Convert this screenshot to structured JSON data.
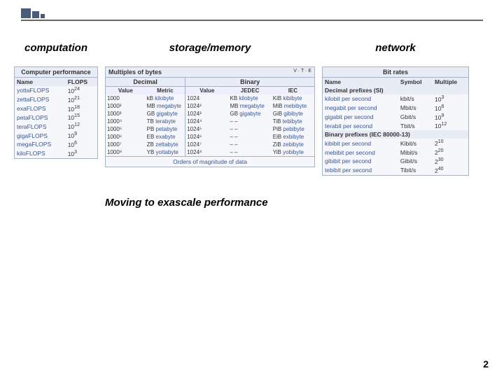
{
  "headers": {
    "computation": "computation",
    "storage": "storage/memory",
    "network": "network"
  },
  "perf": {
    "title": "Computer performance",
    "cols": [
      "Name",
      "FLOPS"
    ],
    "rows": [
      {
        "name": "yottaFLOPS",
        "exp": "24"
      },
      {
        "name": "zettaFLOPS",
        "exp": "21"
      },
      {
        "name": "exaFLOPS",
        "exp": "18"
      },
      {
        "name": "petaFLOPS",
        "exp": "15"
      },
      {
        "name": "teraFLOPS",
        "exp": "12"
      },
      {
        "name": "gigaFLOPS",
        "exp": "9"
      },
      {
        "name": "megaFLOPS",
        "exp": "6"
      },
      {
        "name": "kiloFLOPS",
        "exp": "3"
      }
    ]
  },
  "bytes": {
    "title": "Multiples of bytes",
    "nav": "V · T · E",
    "dec_head": "Decimal",
    "bin_head": "Binary",
    "dec_cols": [
      "Value",
      "Metric"
    ],
    "bin_cols": [
      "Value",
      "JEDEC",
      "IEC"
    ],
    "rows": [
      {
        "dv": "1000",
        "dp": "kB",
        "dn": "kilobyte",
        "bv": "1024",
        "jp": "KB",
        "jn": "kilobyte",
        "ip": "KiB",
        "in": "kibibyte"
      },
      {
        "dv": "1000²",
        "dp": "MB",
        "dn": "megabyte",
        "bv": "1024²",
        "jp": "MB",
        "jn": "megabyte",
        "ip": "MiB",
        "in": "mebibyte"
      },
      {
        "dv": "1000³",
        "dp": "GB",
        "dn": "gigabyte",
        "bv": "1024³",
        "jp": "GB",
        "jn": "gigabyte",
        "ip": "GiB",
        "in": "gibibyte"
      },
      {
        "dv": "1000⁴",
        "dp": "TB",
        "dn": "terabyte",
        "bv": "1024⁴",
        "jp": "–",
        "jn": "–",
        "ip": "TiB",
        "in": "tebibyte"
      },
      {
        "dv": "1000⁵",
        "dp": "PB",
        "dn": "petabyte",
        "bv": "1024⁵",
        "jp": "–",
        "jn": "–",
        "ip": "PiB",
        "in": "pebibyte"
      },
      {
        "dv": "1000⁶",
        "dp": "EB",
        "dn": "exabyte",
        "bv": "1024⁶",
        "jp": "–",
        "jn": "–",
        "ip": "EiB",
        "in": "exbibyte"
      },
      {
        "dv": "1000⁷",
        "dp": "ZB",
        "dn": "zettabyte",
        "bv": "1024⁷",
        "jp": "–",
        "jn": "–",
        "ip": "ZiB",
        "in": "zebibyte"
      },
      {
        "dv": "1000⁸",
        "dp": "YB",
        "dn": "yottabyte",
        "bv": "1024⁸",
        "jp": "–",
        "jn": "–",
        "ip": "YiB",
        "in": "yobibyte"
      }
    ],
    "footer": "Orders of magnitude of data"
  },
  "rates": {
    "title": "Bit rates",
    "cols": [
      "Name",
      "Symbol",
      "Multiple"
    ],
    "dec_head": "Decimal prefixes (SI)",
    "bin_head": "Binary prefixes (IEC 80000-13)",
    "dec": [
      {
        "n": "kilobit per second",
        "s": "kbit/s",
        "exp": "3"
      },
      {
        "n": "megabit per second",
        "s": "Mbit/s",
        "exp": "6"
      },
      {
        "n": "gigabit per second",
        "s": "Gbit/s",
        "exp": "9"
      },
      {
        "n": "terabit per second",
        "s": "Tbit/s",
        "exp": "12"
      }
    ],
    "bin": [
      {
        "n": "kibibit per second",
        "s": "Kibit/s",
        "exp": "10"
      },
      {
        "n": "mebibit per second",
        "s": "Mibit/s",
        "exp": "20"
      },
      {
        "n": "gibibit per second",
        "s": "Gibit/s",
        "exp": "30"
      },
      {
        "n": "tebibit per second",
        "s": "Tibit/s",
        "exp": "40"
      }
    ]
  },
  "caption": "Moving to exascale performance",
  "page": "2"
}
